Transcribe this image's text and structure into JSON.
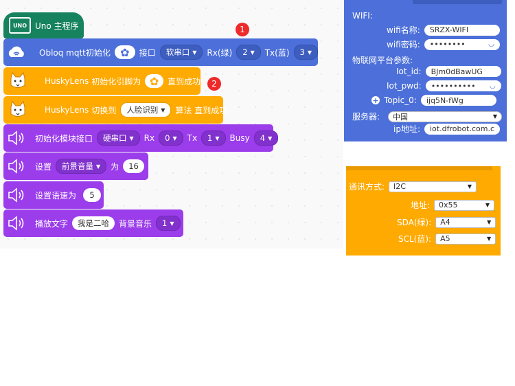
{
  "blocks": {
    "main": {
      "label": "Uno 主程序",
      "icon_text": "UNO"
    },
    "obloq": {
      "init_label": "Obloq mqtt初始化",
      "port_label": "接口",
      "port_value": "软串口",
      "rx_label": "Rx(绿)",
      "rx_value": "2",
      "tx_label": "Tx(蓝)",
      "tx_value": "3"
    },
    "husky_init": {
      "name": "HuskyLens",
      "prefix": "初始化引脚为",
      "suffix": "直到成功"
    },
    "husky_switch": {
      "name": "HuskyLens",
      "prefix": "切换到",
      "algo_value": "人脸识别",
      "suffix": "算法 直到成功"
    },
    "voice_init": {
      "label": "初始化模块接口",
      "port_value": "硬串口",
      "rx_label": "Rx",
      "rx_value": "0",
      "tx_label": "Tx",
      "tx_value": "1",
      "busy_label": "Busy",
      "busy_value": "4"
    },
    "set_volume": {
      "label": "设置",
      "target_value": "前景音量",
      "mid": "为",
      "value": "16"
    },
    "set_speed": {
      "label": "设置语速为",
      "value": "5"
    },
    "play_text": {
      "label": "播放文字",
      "text_value": "我是二哈",
      "bgm_label": "背景音乐",
      "bgm_value": "1"
    }
  },
  "badges": [
    "1",
    "2"
  ],
  "wifi_panel": {
    "wifi_header": "WIFI:",
    "ssid_label": "wifi名称:",
    "ssid_value": "SRZX-WIFI",
    "pwd_label": "wifi密码:",
    "pwd_value": "••••••••",
    "iot_header": "物联网平台参数:",
    "iot_id_label": "Iot_id:",
    "iot_id_value": "BJm0dBawUG",
    "iot_pwd_label": "Iot_pwd:",
    "iot_pwd_value": "••••••••••",
    "topic_label": "Topic_0:",
    "topic_value": "ijq5N-fWg",
    "server_label": "服务器:",
    "server_value": "中国",
    "ip_label": "ip地址:",
    "ip_value": "iot.dfrobot.com.c"
  },
  "i2c_panel": {
    "mode_label": "通讯方式:",
    "mode_value": "I2C",
    "addr_label": "地址:",
    "addr_value": "0x55",
    "sda_label": "SDA(绿):",
    "sda_value": "A4",
    "scl_label": "SCL(蓝):",
    "scl_value": "A5"
  },
  "colors": {
    "main_block": "#17835E",
    "obloq_block": "#4C6FD9",
    "husky_block": "#FFAA00",
    "voice_block": "#9B3DEB",
    "badge": "#EE2A2A"
  }
}
